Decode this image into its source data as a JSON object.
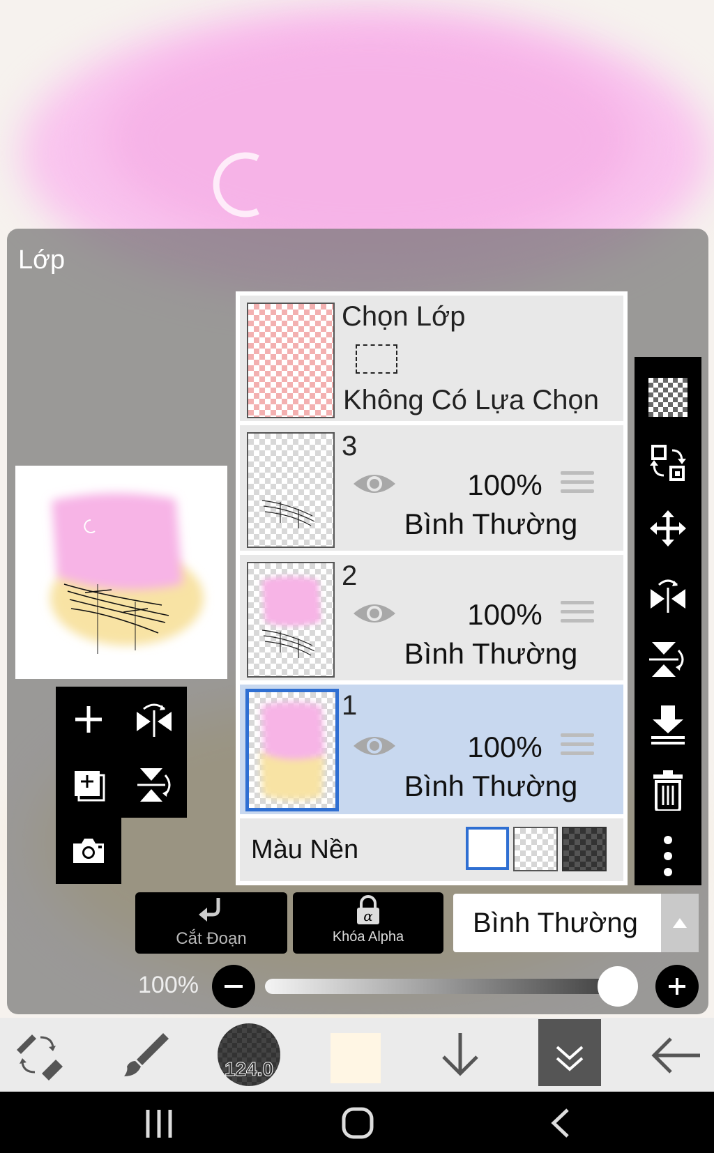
{
  "panel": {
    "title": "Lớp"
  },
  "selection_layer": {
    "title": "Chọn Lớp",
    "subtitle": "Không Có Lựa Chọn"
  },
  "layers": [
    {
      "name": "3",
      "opacity": "100%",
      "mode": "Bình Thường",
      "selected": false
    },
    {
      "name": "2",
      "opacity": "100%",
      "mode": "Bình Thường",
      "selected": false
    },
    {
      "name": "1",
      "opacity": "100%",
      "mode": "Bình Thường",
      "selected": true
    }
  ],
  "background": {
    "label": "Màu Nền",
    "options": [
      "white",
      "transparent",
      "dark-checker"
    ],
    "selected": "white"
  },
  "buttons": {
    "clipping": "Cắt Đoạn",
    "alpha_lock": "Khóa Alpha"
  },
  "blend_mode": {
    "value": "Bình Thường"
  },
  "opacity": {
    "label": "100%",
    "value": 1.0
  },
  "brush": {
    "size": "124.0"
  },
  "colors": {
    "current_color": "#fff6e4",
    "accent": "#2f6fd2",
    "canvas_pink": "#f6b6e8"
  }
}
